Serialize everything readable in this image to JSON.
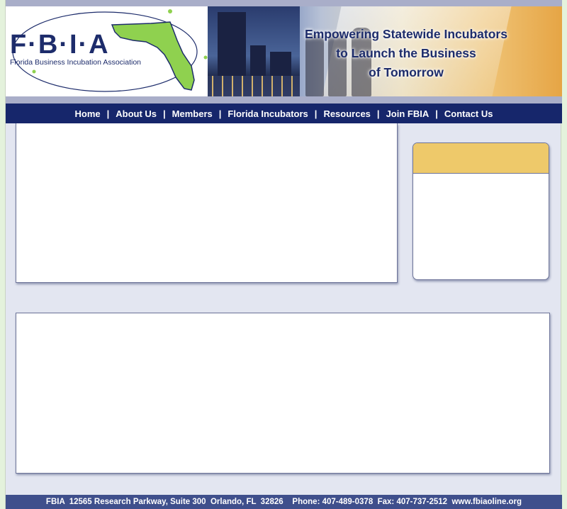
{
  "header": {
    "logo_letters": "F·B·I·A",
    "logo_subtitle": "Florida Business Incubation Association",
    "tagline_lines": [
      "Empowering Statewide Incubators",
      "to Launch the Business",
      "of Tomorrow"
    ]
  },
  "nav": {
    "items": [
      {
        "label": "Home"
      },
      {
        "label": "About Us"
      },
      {
        "label": "Members"
      },
      {
        "label": "Florida Incubators"
      },
      {
        "label": "Resources"
      },
      {
        "label": "Join FBIA"
      },
      {
        "label": "Contact Us"
      }
    ],
    "separator": "|"
  },
  "footer": {
    "text": "FBIA  12565 Research Parkway, Suite 300  Orlando, FL  32826    Phone: 407-489-0378  Fax: 407-737-2512  www.fbiaoline.org"
  },
  "colors": {
    "nav_bg": "#16266b",
    "brand_navy": "#1d2c6b",
    "florida_green": "#8fd14f",
    "sidebox_header": "#eec96a",
    "page_bg": "#e3e6f1",
    "footer_bg": "#3f4f8c"
  }
}
